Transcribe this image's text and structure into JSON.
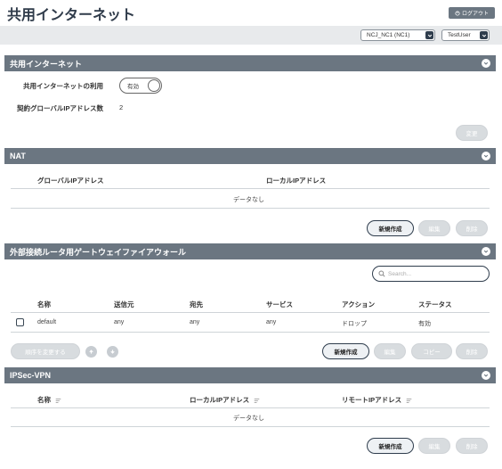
{
  "page": {
    "title": "共用インターネット"
  },
  "header": {
    "logout_label": "ログアウト"
  },
  "topbar": {
    "tenant_select": "NCJ_NC1 (NC1)",
    "user_select": "TestUser"
  },
  "internet": {
    "header": "共用インターネット",
    "usage_label": "共用インターネットの利用",
    "toggle_value": "有効",
    "global_ip_count_label": "契約グローバルIPアドレス数",
    "global_ip_count_value": "2",
    "change_button": "変更"
  },
  "nat": {
    "header": "NAT",
    "columns": [
      "グローバルIPアドレス",
      "ローカルIPアドレス"
    ],
    "empty_text": "データなし",
    "buttons": {
      "create": "新規作成",
      "edit": "編集",
      "delete": "削除"
    }
  },
  "firewall": {
    "header": "外部接続ルータ用ゲートウェイファイアウォール",
    "search_placeholder": "Search...",
    "columns": [
      "名称",
      "送信元",
      "宛先",
      "サービス",
      "アクション",
      "ステータス"
    ],
    "rows": [
      {
        "name": "default",
        "source": "any",
        "destination": "any",
        "service": "any",
        "action": "ドロップ",
        "status": "有効"
      }
    ],
    "buttons": {
      "reorder": "順序を変更する",
      "create": "新規作成",
      "edit": "編集",
      "copy": "コピー",
      "delete": "削除"
    }
  },
  "ipsec": {
    "header": "IPSec-VPN",
    "columns": [
      "名称",
      "ローカルIPアドレス",
      "リモートIPアドレス"
    ],
    "empty_text": "データなし",
    "buttons": {
      "create": "新規作成",
      "edit": "編集",
      "delete": "削除"
    }
  }
}
